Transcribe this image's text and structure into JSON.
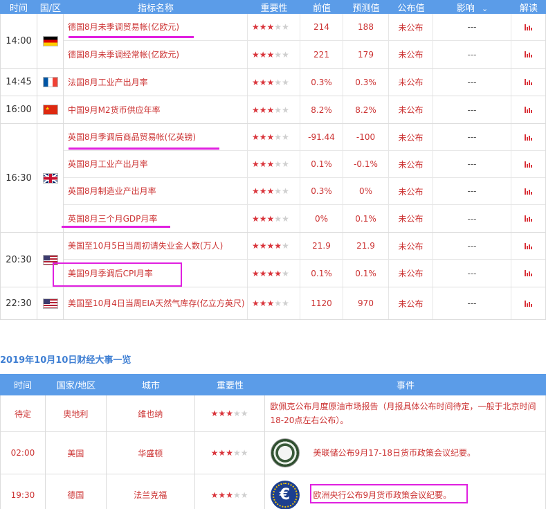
{
  "table1": {
    "headers": {
      "time": "时间",
      "country": "国/区",
      "name": "指标名称",
      "importance": "重要性",
      "previous": "前值",
      "forecast": "预测值",
      "published": "公布值",
      "effect": "影响",
      "explain": "解读"
    },
    "effect_chevron": "chevron-down-icon",
    "groups": [
      {
        "time": "14:00",
        "flag": "germany-flag",
        "rows": [
          {
            "name": "德国8月未季调贸易帐(亿欧元)",
            "stars": 3,
            "previous": "214",
            "forecast": "188",
            "published": "未公布",
            "effect": "---"
          },
          {
            "name": "德国8月未季调经常帐(亿欧元)",
            "stars": 3,
            "previous": "221",
            "forecast": "179",
            "published": "未公布",
            "effect": "---"
          }
        ]
      },
      {
        "time": "14:45",
        "flag": "france-flag",
        "rows": [
          {
            "name": "法国8月工业产出月率",
            "stars": 3,
            "previous": "0.3%",
            "forecast": "0.3%",
            "published": "未公布",
            "effect": "---"
          }
        ]
      },
      {
        "time": "16:00",
        "flag": "china-flag",
        "rows": [
          {
            "name": "中国9月M2货币供应年率",
            "stars": 3,
            "previous": "8.2%",
            "forecast": "8.2%",
            "published": "未公布",
            "effect": "---"
          }
        ]
      },
      {
        "time": "16:30",
        "flag": "uk-flag",
        "rows": [
          {
            "name": "英国8月季调后商品贸易帐(亿英镑)",
            "stars": 3,
            "previous": "-91.44",
            "forecast": "-100",
            "published": "未公布",
            "effect": "---"
          },
          {
            "name": "英国8月工业产出月率",
            "stars": 3,
            "previous": "0.1%",
            "forecast": "-0.1%",
            "published": "未公布",
            "effect": "---"
          },
          {
            "name": "英国8月制造业产出月率",
            "stars": 3,
            "previous": "0.3%",
            "forecast": "0%",
            "published": "未公布",
            "effect": "---"
          },
          {
            "name": "英国8月三个月GDP月率",
            "stars": 3,
            "previous": "0%",
            "forecast": "0.1%",
            "published": "未公布",
            "effect": "---"
          }
        ]
      },
      {
        "time": "20:30",
        "flag": "us-flag",
        "rows": [
          {
            "name": "美国至10月5日当周初请失业金人数(万人)",
            "stars": 4,
            "previous": "21.9",
            "forecast": "21.9",
            "published": "未公布",
            "effect": "---"
          },
          {
            "name": "美国9月季调后CPI月率",
            "stars": 4,
            "previous": "0.1%",
            "forecast": "0.1%",
            "published": "未公布",
            "effect": "---"
          }
        ]
      },
      {
        "time": "22:30",
        "flag": "us-flag",
        "rows": [
          {
            "name": "美国至10月4日当周EIA天然气库存(亿立方英尺)",
            "stars": 3,
            "previous": "1120",
            "forecast": "970",
            "published": "未公布",
            "effect": "---"
          }
        ]
      }
    ]
  },
  "section_title": "2019年10月10日财经大事一览",
  "table2": {
    "headers": {
      "time": "时间",
      "country": "国家/地区",
      "city": "城市",
      "importance": "重要性",
      "event": "事件"
    },
    "rows": [
      {
        "time": "待定",
        "country": "奥地利",
        "city": "维也纳",
        "stars": 3,
        "event": "欧佩克公布月度原油市场报告（月报具体公布时间待定，一般于北京时间18-20点左右公布）。",
        "seal": ""
      },
      {
        "time": "02:00",
        "country": "美国",
        "city": "华盛顿",
        "stars": 3,
        "event": "美联储公布9月17-18日货币政策会议纪要。",
        "seal": "federal-reserve-seal"
      },
      {
        "time": "19:30",
        "country": "德国",
        "city": "法兰克福",
        "stars": 3,
        "event": "欧洲央行公布9月货币政策会议纪要。",
        "seal": "ecb-euro-seal"
      }
    ]
  },
  "colors": {
    "header_bg": "#5b9ce8",
    "value_red": "#cc3333",
    "star_on": "#d9343b",
    "star_off": "#cfcfcf",
    "annotation_magenta": "#e020e0",
    "section_title_blue": "#3f7fd3"
  }
}
